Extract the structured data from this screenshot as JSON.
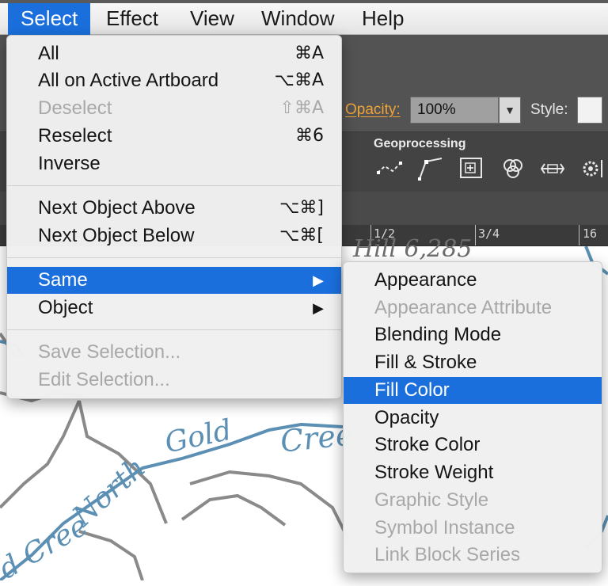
{
  "menubar": {
    "items": [
      "Select",
      "Effect",
      "View",
      "Window",
      "Help"
    ],
    "active_index": 0
  },
  "control_bar": {
    "opacity_label": "Opacity:",
    "opacity_value": "100%",
    "style_label": "Style:"
  },
  "panel_bar": {
    "geoprocessing_label": "Geoprocessing"
  },
  "ruler": {
    "labels": [
      "1/2",
      "3/4",
      "16"
    ]
  },
  "map": {
    "labels": [
      "Hill 6,285",
      "Gold",
      "Cree",
      "North",
      "d Cree"
    ]
  },
  "select_menu": {
    "items": [
      {
        "label": "All",
        "shortcut": "⌘A",
        "disabled": false
      },
      {
        "label": "All on Active Artboard",
        "shortcut": "⌥⌘A",
        "disabled": false
      },
      {
        "label": "Deselect",
        "shortcut": "⇧⌘A",
        "disabled": true
      },
      {
        "label": "Reselect",
        "shortcut": "⌘6",
        "disabled": false
      },
      {
        "label": "Inverse",
        "shortcut": "",
        "disabled": false
      },
      {
        "label": "Next Object Above",
        "shortcut": "⌥⌘]",
        "disabled": false
      },
      {
        "label": "Next Object Below",
        "shortcut": "⌥⌘[",
        "disabled": false
      },
      {
        "label": "Same",
        "submenu": true,
        "highlighted": true
      },
      {
        "label": "Object",
        "submenu": true
      },
      {
        "label": "Save Selection...",
        "disabled": true
      },
      {
        "label": "Edit Selection...",
        "disabled": true
      }
    ]
  },
  "same_submenu": {
    "items": [
      {
        "label": "Appearance",
        "disabled": false
      },
      {
        "label": "Appearance Attribute",
        "disabled": true
      },
      {
        "label": "Blending Mode",
        "disabled": false
      },
      {
        "label": "Fill & Stroke",
        "disabled": false
      },
      {
        "label": "Fill Color",
        "disabled": false,
        "highlighted": true
      },
      {
        "label": "Opacity",
        "disabled": false
      },
      {
        "label": "Stroke Color",
        "disabled": false
      },
      {
        "label": "Stroke Weight",
        "disabled": false
      },
      {
        "label": "Graphic Style",
        "disabled": true
      },
      {
        "label": "Symbol Instance",
        "disabled": true
      },
      {
        "label": "Link Block Series",
        "disabled": true
      }
    ]
  },
  "colors": {
    "highlight": "#1a6fdc",
    "river": "#5b8fb3",
    "contour": "#8a8a8a",
    "opacity_label": "#f0a33a"
  }
}
